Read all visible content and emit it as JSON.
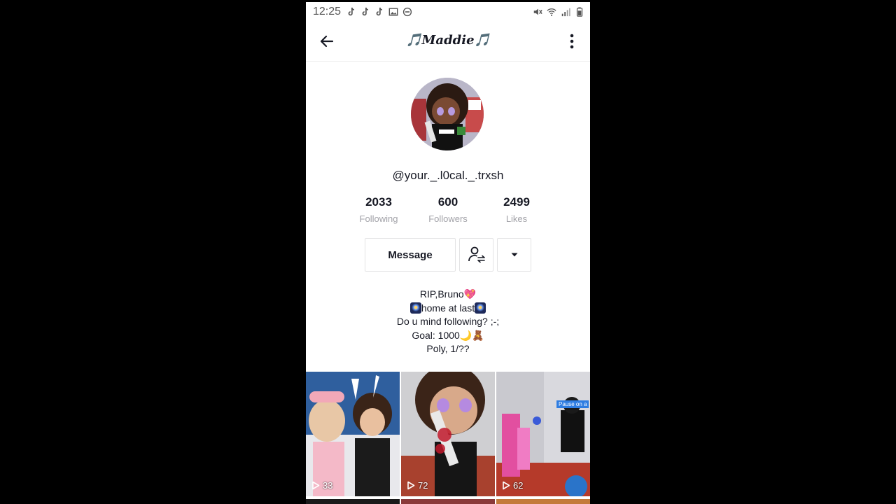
{
  "status_bar": {
    "time": "12:25",
    "left_icons": [
      "tiktok-icon",
      "tiktok-icon",
      "tiktok-icon",
      "gallery-icon",
      "do-not-disturb-icon"
    ],
    "right_icons": [
      "mute-icon",
      "wifi-icon",
      "signal-icon",
      "battery-icon"
    ]
  },
  "header": {
    "title": "🎵Maddie🎵",
    "back_icon": "arrow-left-icon",
    "more_icon": "more-vertical-icon"
  },
  "profile": {
    "username": "@your._.l0cal._.trxsh",
    "stats": [
      {
        "value": "2033",
        "label": "Following"
      },
      {
        "value": "600",
        "label": "Followers"
      },
      {
        "value": "2499",
        "label": "Likes"
      }
    ],
    "buttons": {
      "message": "Message",
      "friend_icon": "user-follow-swap-icon",
      "dropdown_icon": "caret-down-icon"
    },
    "bio": {
      "line1": "RIP,Bruno💖",
      "line2_text": "home at last",
      "line3": "Do u mind following? ;-;",
      "line4": "Goal: 1000🌙🧸",
      "line5": "Poly, 1/??"
    }
  },
  "videos": [
    {
      "views": "33",
      "play_icon": "play-icon"
    },
    {
      "views": "72",
      "play_icon": "play-icon"
    },
    {
      "views": "62",
      "play_icon": "play-icon",
      "overlay_text": "Pause on a"
    }
  ],
  "colors": {
    "text_primary": "#161823",
    "text_secondary": "#a2a2a8",
    "border": "#e3e3e4"
  }
}
